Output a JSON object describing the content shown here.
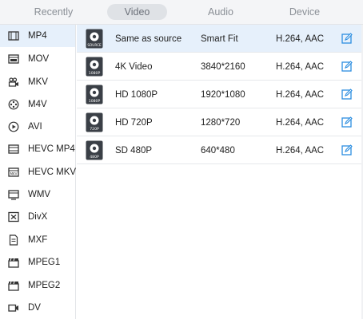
{
  "tabs": [
    {
      "label": "Recently",
      "active": false
    },
    {
      "label": "Video",
      "active": true
    },
    {
      "label": "Audio",
      "active": false
    },
    {
      "label": "Device",
      "active": false
    }
  ],
  "sidebar": {
    "items": [
      {
        "label": "MP4",
        "icon": "film-strip-icon",
        "selected": true
      },
      {
        "label": "MOV",
        "icon": "film-frame-icon",
        "selected": false
      },
      {
        "label": "MKV",
        "icon": "video-camera-icon",
        "selected": false
      },
      {
        "label": "M4V",
        "icon": "film-reel-icon",
        "selected": false
      },
      {
        "label": "AVI",
        "icon": "play-circle-icon",
        "selected": false
      },
      {
        "label": "HEVC MP4",
        "icon": "hevc-film-icon",
        "selected": false
      },
      {
        "label": "HEVC MKV",
        "icon": "hevc-film-icon",
        "selected": false
      },
      {
        "label": "WMV",
        "icon": "monitor-icon",
        "selected": false
      },
      {
        "label": "DivX",
        "icon": "close-box-icon",
        "selected": false
      },
      {
        "label": "MXF",
        "icon": "document-icon",
        "selected": false
      },
      {
        "label": "MPEG1",
        "icon": "clapperboard-icon",
        "selected": false
      },
      {
        "label": "MPEG2",
        "icon": "clapperboard-icon",
        "selected": false
      },
      {
        "label": "DV",
        "icon": "camcorder-icon",
        "selected": false
      }
    ]
  },
  "presets": [
    {
      "name": "Same as source",
      "resolution": "Smart Fit",
      "codec": "H.264, AAC",
      "badge": "SOURCE",
      "selected": true
    },
    {
      "name": "4K Video",
      "resolution": "3840*2160",
      "codec": "H.264, AAC",
      "badge": "1080P",
      "selected": false
    },
    {
      "name": "HD 1080P",
      "resolution": "1920*1080",
      "codec": "H.264, AAC",
      "badge": "1080P",
      "selected": false
    },
    {
      "name": "HD 720P",
      "resolution": "1280*720",
      "codec": "H.264, AAC",
      "badge": "720P",
      "selected": false
    },
    {
      "name": "SD 480P",
      "resolution": "640*480",
      "codec": "H.264, AAC",
      "badge": "480P",
      "selected": false
    }
  ],
  "colors": {
    "accent": "#2b8de0",
    "selected_bg": "#e6f0fb",
    "thumb": "#3a3f46"
  }
}
